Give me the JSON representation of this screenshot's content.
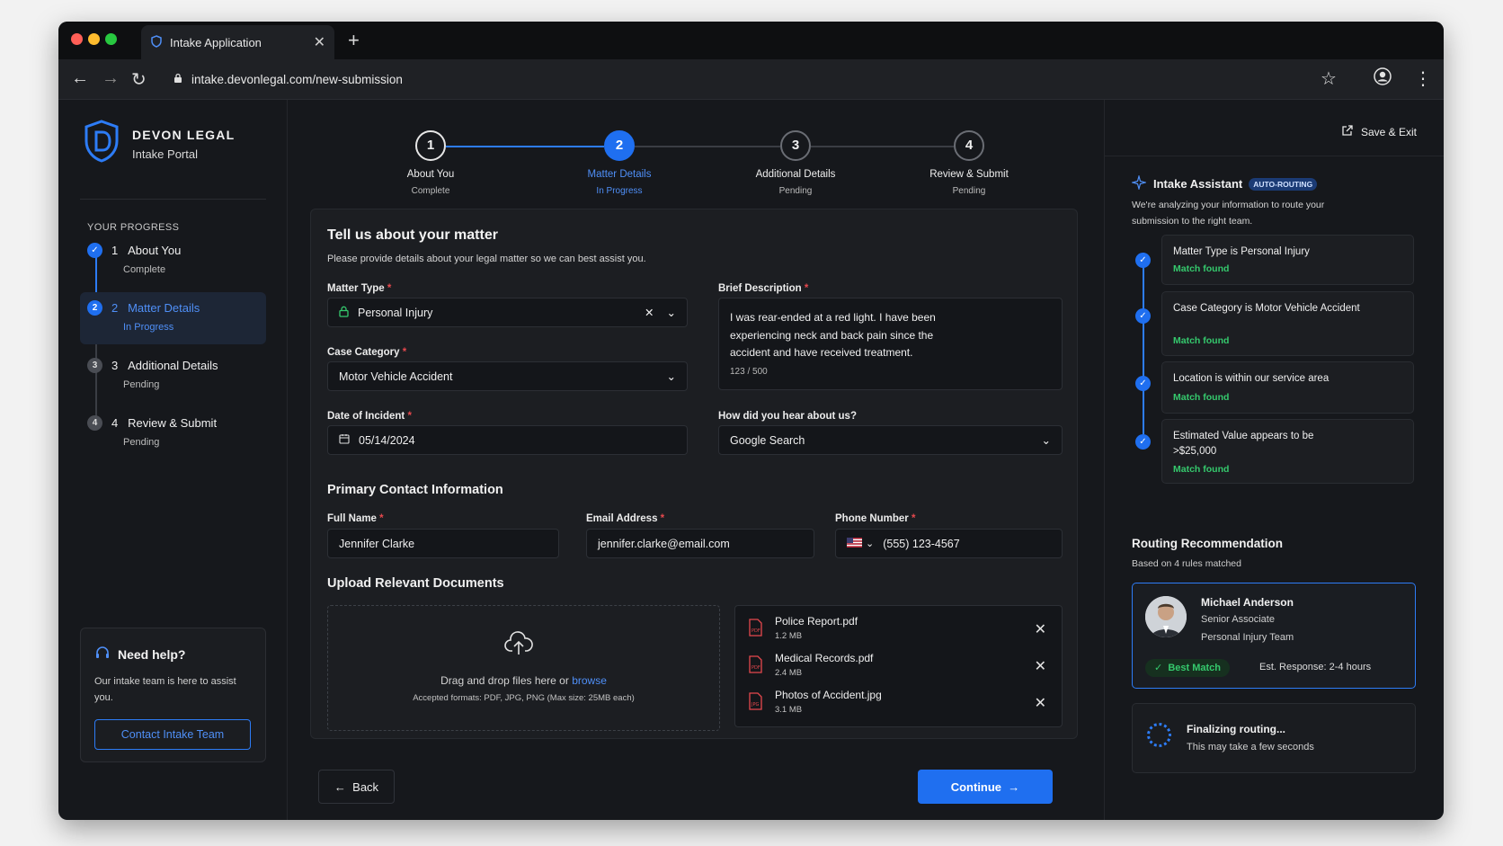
{
  "browser": {
    "tab_title": "Intake Application",
    "url": "intake.devonlegal.com/new-submission"
  },
  "brand": {
    "name": "DEVON LEGAL",
    "subtitle": "Intake Portal"
  },
  "sidebar": {
    "progress_title": "YOUR PROGRESS",
    "steps": [
      {
        "num": "1",
        "label": "About You",
        "status": "Complete"
      },
      {
        "num": "2",
        "label": "Matter Details",
        "status": "In Progress"
      },
      {
        "num": "3",
        "label": "Additional Details",
        "status": "Pending"
      },
      {
        "num": "4",
        "label": "Review & Submit",
        "status": "Pending"
      }
    ],
    "help": {
      "title": "Need help?",
      "text": "Our intake team is here to assist you.",
      "button": "Contact Intake Team"
    }
  },
  "stepper": [
    {
      "num": "1",
      "label": "About You",
      "status": "Complete"
    },
    {
      "num": "2",
      "label": "Matter Details",
      "status": "In Progress"
    },
    {
      "num": "3",
      "label": "Additional Details",
      "status": "Pending"
    },
    {
      "num": "4",
      "label": "Review & Submit",
      "status": "Pending"
    }
  ],
  "form": {
    "title": "Tell us about your matter",
    "lead": "Please provide details about your legal matter so we can best assist you.",
    "matter_type": {
      "label": "Matter Type",
      "value": "Personal Injury"
    },
    "brief": {
      "label": "Brief Description",
      "value": "I was rear-ended at a red light. I have been experiencing neck and back pain since the accident and have received treatment.",
      "counter": "123 / 500"
    },
    "case_category": {
      "label": "Case Category",
      "value": "Motor Vehicle Accident"
    },
    "date": {
      "label": "Date of Incident",
      "value": "05/14/2024"
    },
    "referral": {
      "label": "How did you hear about us?",
      "value": "Google Search"
    },
    "contact_title": "Primary Contact Information",
    "full_name": {
      "label": "Full Name",
      "value": "Jennifer Clarke"
    },
    "email": {
      "label": "Email Address",
      "value": "jennifer.clarke@email.com"
    },
    "phone": {
      "label": "Phone Number",
      "value": "(555) 123-4567"
    },
    "upload_title": "Upload Relevant Documents",
    "drop_text": "Drag and drop files here or",
    "drop_link": "browse",
    "drop_sub": "Accepted formats: PDF, JPG, PNG (Max size: 25MB each)",
    "files": [
      {
        "name": "Police Report.pdf",
        "size": "1.2 MB"
      },
      {
        "name": "Medical Records.pdf",
        "size": "2.4 MB"
      },
      {
        "name": "Photos of Accident.jpg",
        "size": "3.1 MB"
      }
    ],
    "back": "Back",
    "continue": "Continue"
  },
  "assistant": {
    "save_exit": "Save & Exit",
    "title": "Intake Assistant",
    "badge": "AUTO-ROUTING",
    "desc": "We're analyzing your information to route your submission to the right team.",
    "checks": [
      {
        "text": "Matter Type is Personal Injury",
        "status": "Match found"
      },
      {
        "text": "Case Category is Motor Vehicle Accident",
        "status": "Match found"
      },
      {
        "text": "Location is within our service area",
        "status": "Match found"
      },
      {
        "text": "Estimated Value appears to be >$25,000",
        "status": "Match found"
      }
    ],
    "routing_title": "Routing Recommendation",
    "routing_sub": "Based on 4 rules matched",
    "attorney": {
      "name": "Michael Anderson",
      "role": "Senior Associate",
      "team": "Personal Injury Team",
      "badge": "Best Match",
      "eta": "Est. Response: 2-4 hours"
    },
    "final_title": "Finalizing routing...",
    "final_sub": "This may take a few seconds"
  },
  "colors": {
    "accent": "#1f6ff0",
    "success": "#35c96d",
    "required": "#e5484d"
  }
}
